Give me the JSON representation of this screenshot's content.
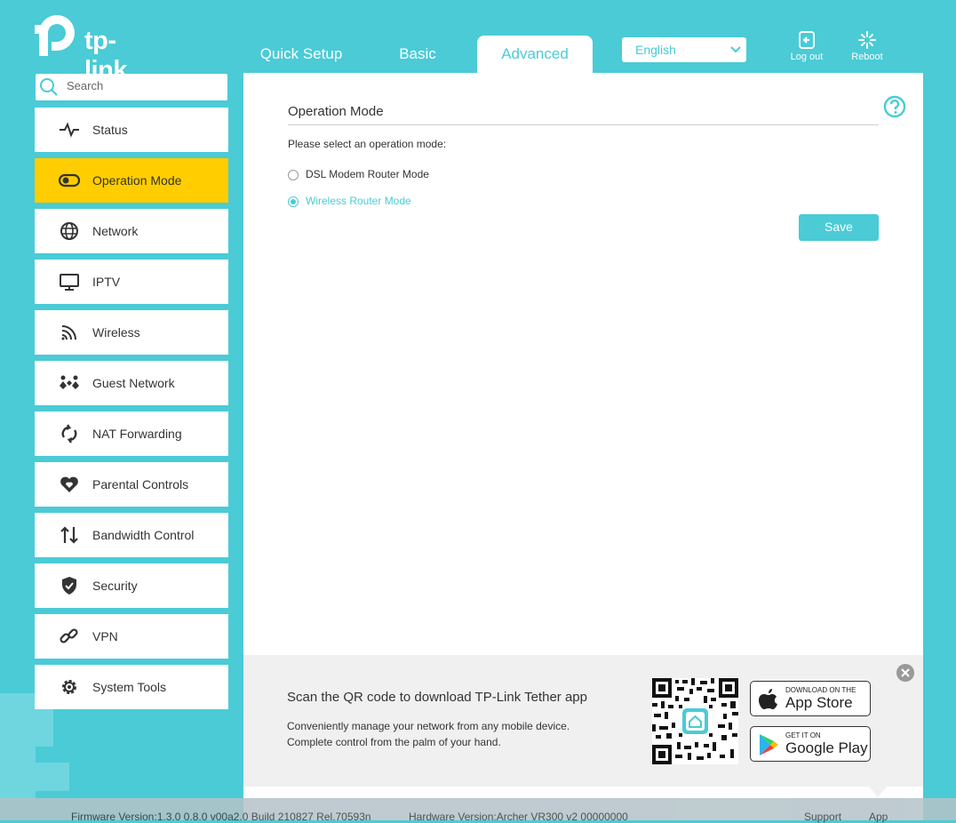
{
  "brand": {
    "logo_text": "tp-link",
    "accent_color": "#4acbd6",
    "active_color": "#ffcd00"
  },
  "tabs": [
    {
      "label": "Quick Setup",
      "active": false
    },
    {
      "label": "Basic",
      "active": false
    },
    {
      "label": "Advanced",
      "active": true
    }
  ],
  "language": {
    "selected": "English"
  },
  "header_actions": {
    "logout": "Log out",
    "reboot": "Reboot"
  },
  "sidebar": {
    "search_placeholder": "Search",
    "items": [
      {
        "label": "Status",
        "icon": "pulse-icon"
      },
      {
        "label": "Operation Mode",
        "icon": "toggle-icon",
        "active": true
      },
      {
        "label": "Network",
        "icon": "globe-icon"
      },
      {
        "label": "IPTV",
        "icon": "monitor-icon"
      },
      {
        "label": "Wireless",
        "icon": "wifi-icon"
      },
      {
        "label": "Guest Network",
        "icon": "guest-icon"
      },
      {
        "label": "NAT Forwarding",
        "icon": "refresh-icon"
      },
      {
        "label": "Parental Controls",
        "icon": "heart-icon"
      },
      {
        "label": "Bandwidth Control",
        "icon": "updown-arrows-icon"
      },
      {
        "label": "Security",
        "icon": "shield-icon"
      },
      {
        "label": "VPN",
        "icon": "link-icon"
      },
      {
        "label": "System Tools",
        "icon": "gear-icon"
      }
    ]
  },
  "main": {
    "title": "Operation Mode",
    "instruction": "Please select an operation mode:",
    "options": [
      {
        "label": "DSL Modem Router Mode",
        "checked": false
      },
      {
        "label": "Wireless Router Mode",
        "checked": true
      }
    ],
    "save_label": "Save"
  },
  "app_banner": {
    "title": "Scan the QR code to download TP-Link Tether app",
    "line1": "Conveniently manage your network from any mobile device.",
    "line2": "Complete control from the palm of your hand.",
    "app_store_small": "DOWNLOAD ON THE",
    "app_store_big": "App Store",
    "google_small": "GET IT ON",
    "google_big": "Google Play"
  },
  "footer": {
    "firmware": "Firmware Version:1.3.0 0.8.0 v00a2.0 Build 210827 Rel.70593n",
    "hardware": "Hardware Version:Archer VR300 v2 00000000",
    "support": "Support",
    "app": "App"
  }
}
